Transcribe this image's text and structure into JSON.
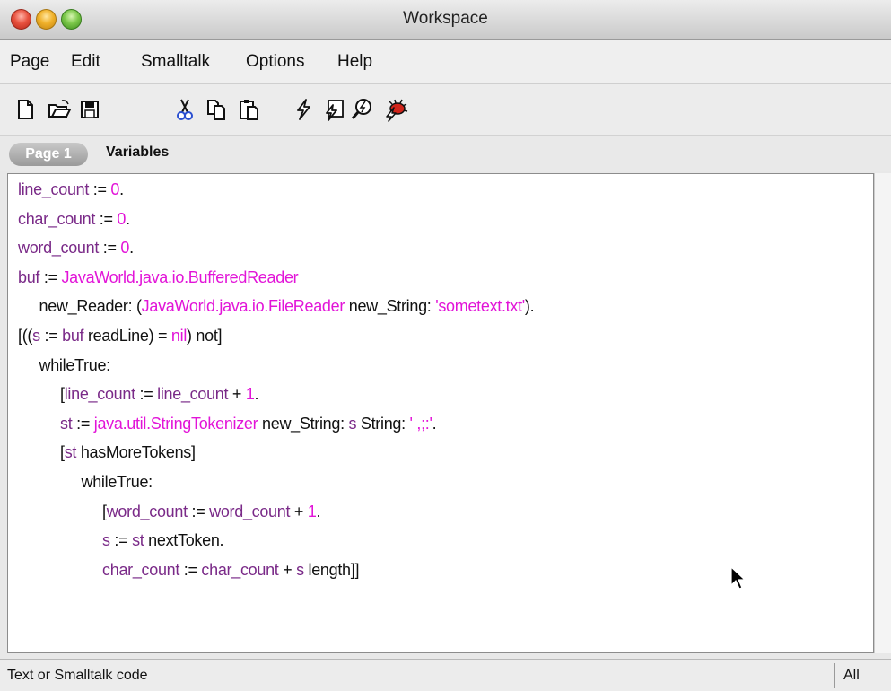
{
  "window": {
    "title": "Workspace"
  },
  "menu": {
    "items": [
      "Page",
      "Edit",
      "Smalltalk",
      "Options",
      "Help"
    ]
  },
  "toolbar": {
    "icons": [
      "new-page-icon",
      "open-folder-icon",
      "save-icon",
      "cut-icon",
      "copy-icon",
      "paste-icon",
      "do-it-icon",
      "print-it-icon",
      "inspect-it-icon",
      "debug-it-icon"
    ]
  },
  "tabs": {
    "active": "Page 1",
    "other": "Variables"
  },
  "code": {
    "lines": [
      [
        [
          "purple",
          "line_count"
        ],
        [
          "black",
          " := "
        ],
        [
          "magenta",
          "0"
        ],
        [
          "black",
          "."
        ]
      ],
      [
        [
          "purple",
          "char_count"
        ],
        [
          "black",
          " := "
        ],
        [
          "magenta",
          "0"
        ],
        [
          "black",
          "."
        ]
      ],
      [
        [
          "purple",
          "word_count"
        ],
        [
          "black",
          " := "
        ],
        [
          "magenta",
          "0"
        ],
        [
          "black",
          "."
        ]
      ],
      [
        [
          "purple",
          "buf"
        ],
        [
          "black",
          " := "
        ],
        [
          "magenta",
          "JavaWorld.java.io.BufferedReader"
        ]
      ],
      [
        [
          "black",
          "     new_Reader: ("
        ],
        [
          "magenta",
          "JavaWorld.java.io.FileReader"
        ],
        [
          "black",
          " new_String: "
        ],
        [
          "magenta",
          "'sometext.txt'"
        ],
        [
          "black",
          ")."
        ]
      ],
      [
        [
          "black",
          "[(("
        ],
        [
          "purple",
          "s"
        ],
        [
          "black",
          " := "
        ],
        [
          "purple",
          "buf"
        ],
        [
          "black",
          " readLine) = "
        ],
        [
          "magenta",
          "nil"
        ],
        [
          "black",
          ") not]"
        ]
      ],
      [
        [
          "black",
          "     whileTrue:"
        ]
      ],
      [
        [
          "black",
          "          ["
        ],
        [
          "purple",
          "line_count"
        ],
        [
          "black",
          " := "
        ],
        [
          "purple",
          "line_count"
        ],
        [
          "black",
          " + "
        ],
        [
          "magenta",
          "1"
        ],
        [
          "black",
          "."
        ]
      ],
      [
        [
          "black",
          "          "
        ],
        [
          "purple",
          "st"
        ],
        [
          "black",
          " := "
        ],
        [
          "magenta",
          "java.util.StringTokenizer"
        ],
        [
          "black",
          " new_String: "
        ],
        [
          "purple",
          "s"
        ],
        [
          "black",
          " String: "
        ],
        [
          "magenta",
          "' ,;:'"
        ],
        [
          "black",
          "."
        ]
      ],
      [
        [
          "black",
          "          ["
        ],
        [
          "purple",
          "st"
        ],
        [
          "black",
          " hasMoreTokens]"
        ]
      ],
      [
        [
          "black",
          "               whileTrue:"
        ]
      ],
      [
        [
          "black",
          "                    ["
        ],
        [
          "purple",
          "word_count"
        ],
        [
          "black",
          " := "
        ],
        [
          "purple",
          "word_count"
        ],
        [
          "black",
          " + "
        ],
        [
          "magenta",
          "1"
        ],
        [
          "black",
          "."
        ]
      ],
      [
        [
          "black",
          "                    "
        ],
        [
          "purple",
          "s"
        ],
        [
          "black",
          " := "
        ],
        [
          "purple",
          "st"
        ],
        [
          "black",
          " nextToken."
        ]
      ],
      [
        [
          "black",
          "                    "
        ],
        [
          "purple",
          "char_count"
        ],
        [
          "black",
          " := "
        ],
        [
          "purple",
          "char_count"
        ],
        [
          "black",
          " + "
        ],
        [
          "purple",
          "s"
        ],
        [
          "black",
          " length]]"
        ]
      ]
    ]
  },
  "status": {
    "text": "Text or Smalltalk code",
    "mode": "All"
  }
}
